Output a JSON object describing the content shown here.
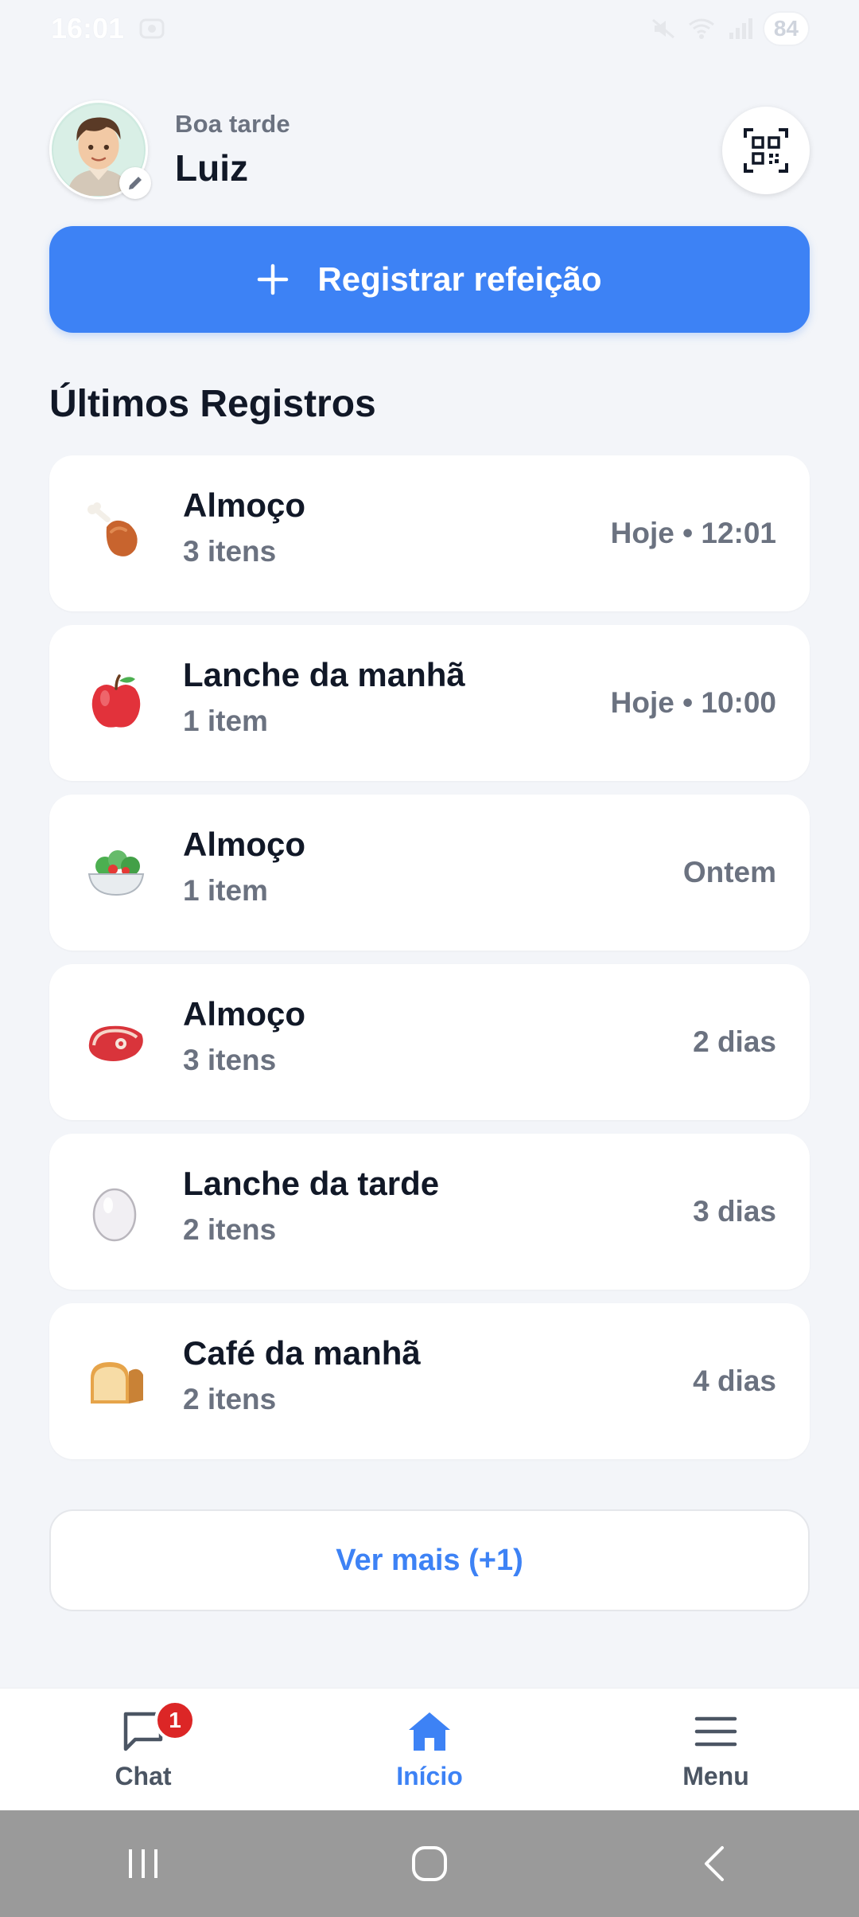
{
  "status": {
    "time": "16:01",
    "battery": "84"
  },
  "header": {
    "greeting": "Boa tarde",
    "name": "Luiz"
  },
  "actions": {
    "register_meal": "Registrar refeição"
  },
  "section": {
    "title": "Últimos Registros"
  },
  "records": [
    {
      "title": "Almoço",
      "subtitle": "3 itens",
      "time": "Hoje • 12:01",
      "icon": "chicken-leg-icon"
    },
    {
      "title": "Lanche da manhã",
      "subtitle": "1 item",
      "time": "Hoje • 10:00",
      "icon": "apple-icon"
    },
    {
      "title": "Almoço",
      "subtitle": "1 item",
      "time": "Ontem",
      "icon": "salad-icon"
    },
    {
      "title": "Almoço",
      "subtitle": "3 itens",
      "time": "2 dias",
      "icon": "meat-icon"
    },
    {
      "title": "Lanche da tarde",
      "subtitle": "2 itens",
      "time": "3 dias",
      "icon": "egg-icon"
    },
    {
      "title": "Café da manhã",
      "subtitle": "2 itens",
      "time": "4 dias",
      "icon": "bread-icon"
    }
  ],
  "more": {
    "label": "Ver mais (+1)"
  },
  "nav": {
    "chat": "Chat",
    "chat_badge": "1",
    "home": "Início",
    "menu": "Menu"
  },
  "colors": {
    "accent": "#3d82f5",
    "background": "#f3f5f9",
    "badge": "#dc2626"
  }
}
